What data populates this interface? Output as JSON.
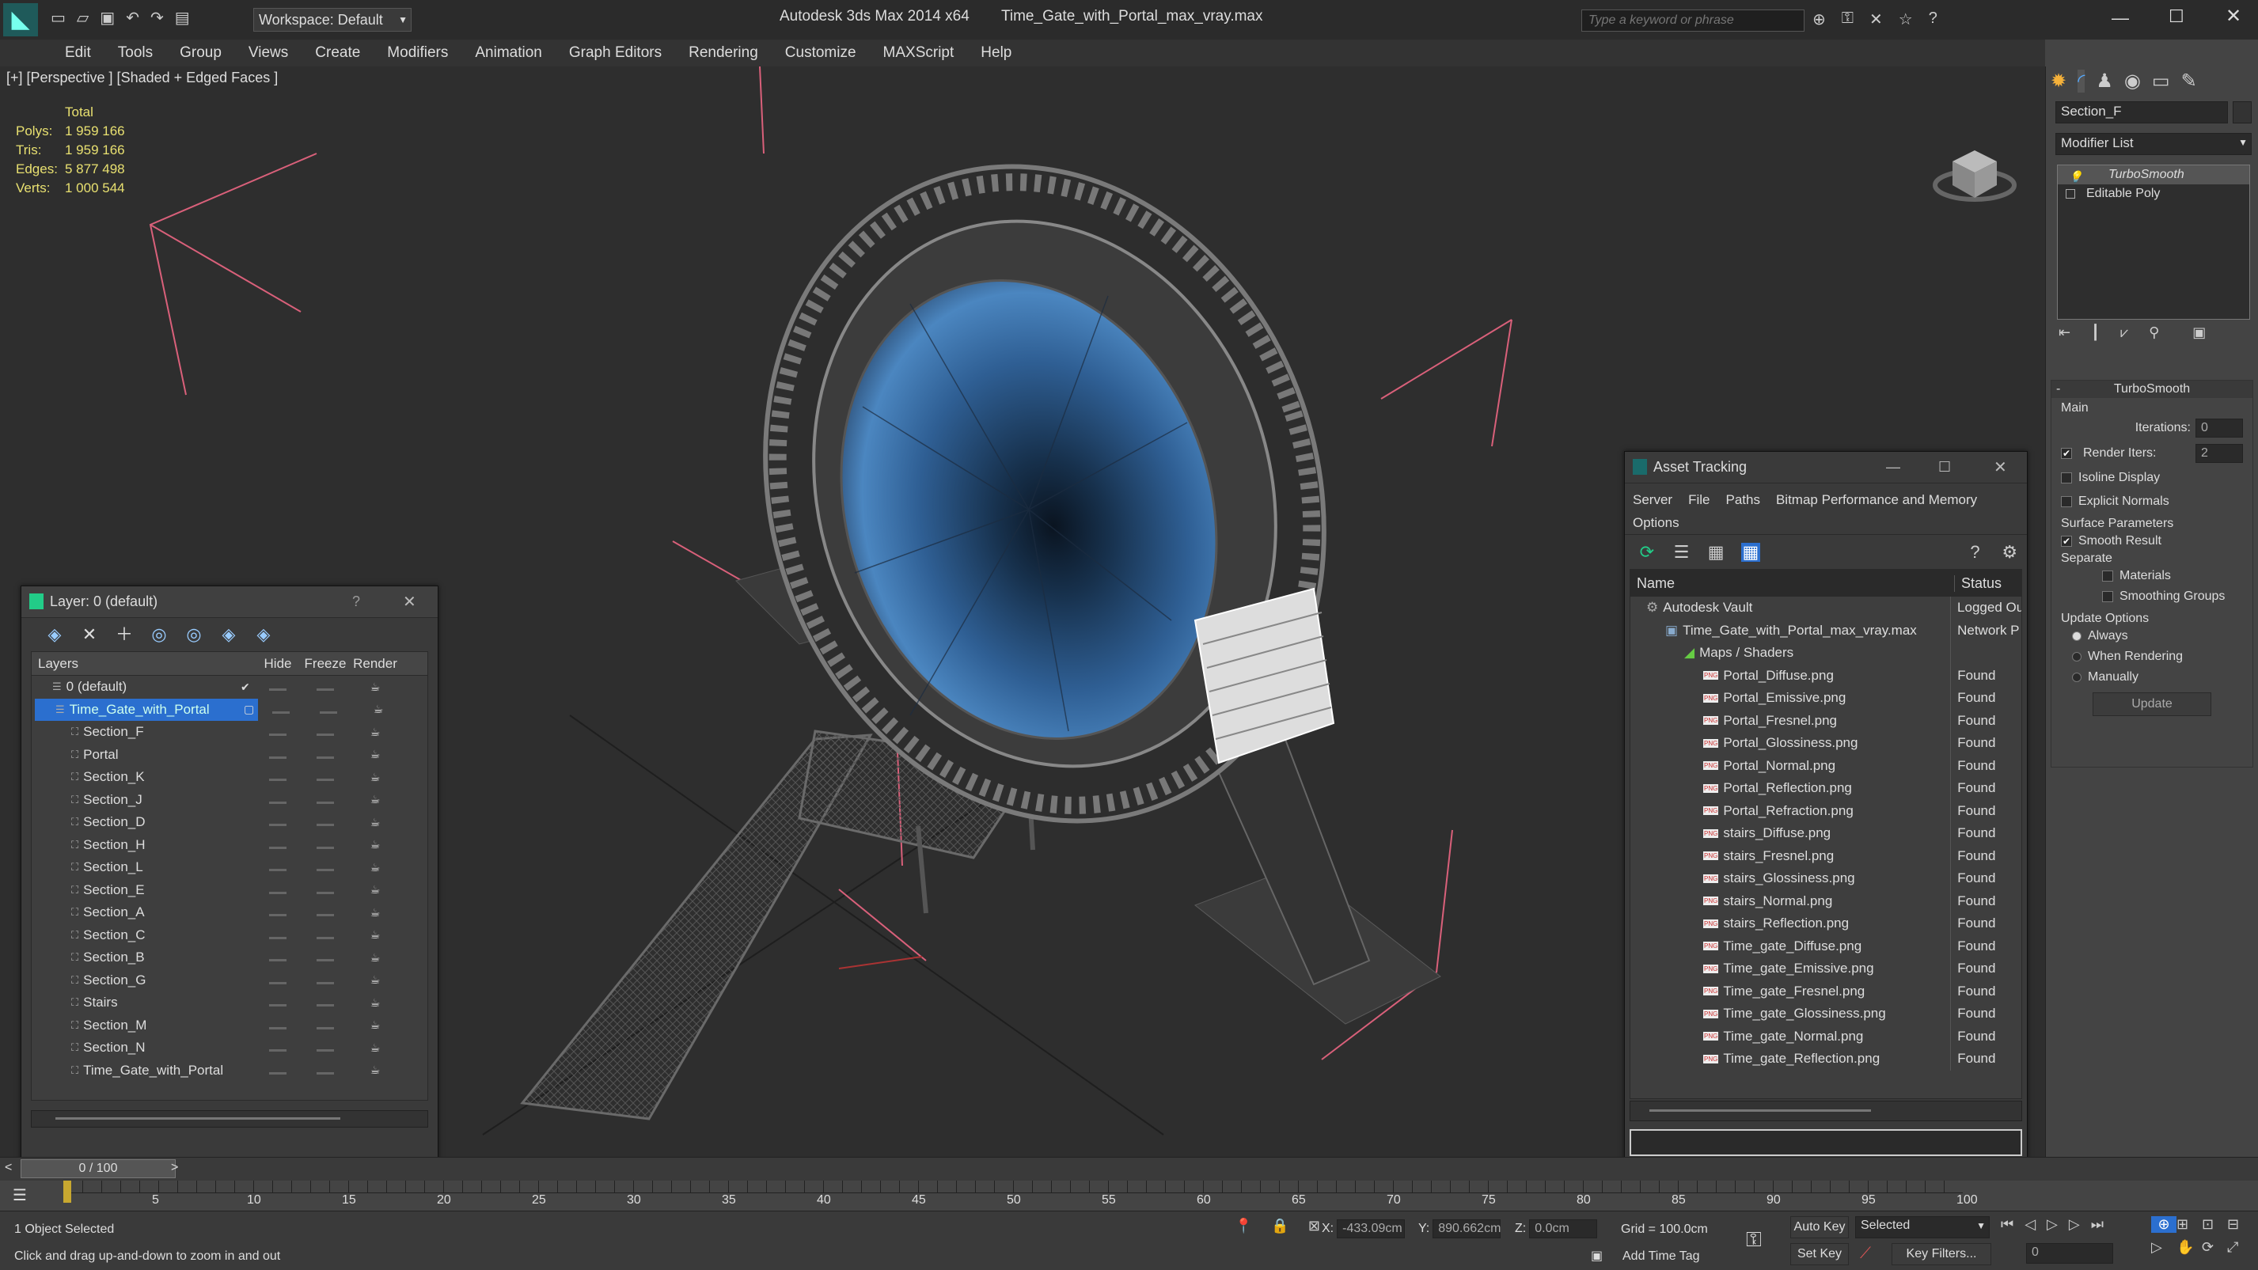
{
  "app": {
    "title": "Autodesk 3ds Max  2014 x64",
    "file": "Time_Gate_with_Portal_max_vray.max",
    "workspace": "Workspace: Default",
    "search_placeholder": "Type a keyword or phrase"
  },
  "menu": [
    "Edit",
    "Tools",
    "Group",
    "Views",
    "Create",
    "Modifiers",
    "Animation",
    "Graph Editors",
    "Rendering",
    "Customize",
    "MAXScript",
    "Help"
  ],
  "viewport": {
    "label": "[+] [Perspective ] [Shaded + Edged Faces ]",
    "stats_header": "Total",
    "stats": [
      {
        "label": "Polys:",
        "value": "1 959 166"
      },
      {
        "label": "Tris:",
        "value": "1 959 166"
      },
      {
        "label": "Edges:",
        "value": "5 877 498"
      },
      {
        "label": "Verts:",
        "value": "1 000 544"
      }
    ]
  },
  "layer_window": {
    "title": "Layer: 0 (default)",
    "help": "?",
    "columns": [
      "Layers",
      "Hide",
      "Freeze",
      "Render"
    ],
    "layers": [
      {
        "name": "0 (default)",
        "level": 0,
        "selected": false
      },
      {
        "name": "Time_Gate_with_Portal",
        "level": 0,
        "selected": true
      },
      {
        "name": "Section_F",
        "level": 1,
        "selected": false
      },
      {
        "name": "Portal",
        "level": 1,
        "selected": false
      },
      {
        "name": "Section_K",
        "level": 1,
        "selected": false
      },
      {
        "name": "Section_J",
        "level": 1,
        "selected": false
      },
      {
        "name": "Section_D",
        "level": 1,
        "selected": false
      },
      {
        "name": "Section_H",
        "level": 1,
        "selected": false
      },
      {
        "name": "Section_L",
        "level": 1,
        "selected": false
      },
      {
        "name": "Section_E",
        "level": 1,
        "selected": false
      },
      {
        "name": "Section_A",
        "level": 1,
        "selected": false
      },
      {
        "name": "Section_C",
        "level": 1,
        "selected": false
      },
      {
        "name": "Section_B",
        "level": 1,
        "selected": false
      },
      {
        "name": "Section_G",
        "level": 1,
        "selected": false
      },
      {
        "name": "Stairs",
        "level": 1,
        "selected": false
      },
      {
        "name": "Section_M",
        "level": 1,
        "selected": false
      },
      {
        "name": "Section_N",
        "level": 1,
        "selected": false
      },
      {
        "name": "Time_Gate_with_Portal",
        "level": 1,
        "selected": false
      }
    ]
  },
  "asset_window": {
    "title": "Asset Tracking",
    "menu": [
      "Server",
      "File",
      "Paths",
      "Bitmap Performance and Memory"
    ],
    "menu2": "Options",
    "columns": [
      "Name",
      "Status"
    ],
    "rows": [
      {
        "name": "Autodesk Vault",
        "status": "Logged Ou",
        "level": 0
      },
      {
        "name": "Time_Gate_with_Portal_max_vray.max",
        "status": "Network P",
        "level": 1
      },
      {
        "name": "Maps / Shaders",
        "status": "",
        "level": 2
      },
      {
        "name": "Portal_Diffuse.png",
        "status": "Found",
        "level": 3
      },
      {
        "name": "Portal_Emissive.png",
        "status": "Found",
        "level": 3
      },
      {
        "name": "Portal_Fresnel.png",
        "status": "Found",
        "level": 3
      },
      {
        "name": "Portal_Glossiness.png",
        "status": "Found",
        "level": 3
      },
      {
        "name": "Portal_Normal.png",
        "status": "Found",
        "level": 3
      },
      {
        "name": "Portal_Reflection.png",
        "status": "Found",
        "level": 3
      },
      {
        "name": "Portal_Refraction.png",
        "status": "Found",
        "level": 3
      },
      {
        "name": "stairs_Diffuse.png",
        "status": "Found",
        "level": 3
      },
      {
        "name": "stairs_Fresnel.png",
        "status": "Found",
        "level": 3
      },
      {
        "name": "stairs_Glossiness.png",
        "status": "Found",
        "level": 3
      },
      {
        "name": "stairs_Normal.png",
        "status": "Found",
        "level": 3
      },
      {
        "name": "stairs_Reflection.png",
        "status": "Found",
        "level": 3
      },
      {
        "name": "Time_gate_Diffuse.png",
        "status": "Found",
        "level": 3
      },
      {
        "name": "Time_gate_Emissive.png",
        "status": "Found",
        "level": 3
      },
      {
        "name": "Time_gate_Fresnel.png",
        "status": "Found",
        "level": 3
      },
      {
        "name": "Time_gate_Glossiness.png",
        "status": "Found",
        "level": 3
      },
      {
        "name": "Time_gate_Normal.png",
        "status": "Found",
        "level": 3
      },
      {
        "name": "Time_gate_Reflection.png",
        "status": "Found",
        "level": 3
      }
    ]
  },
  "cmd_panel": {
    "object_name": "Section_F",
    "modifier_list": "Modifier List",
    "stack": [
      "TurboSmooth",
      "Editable Poly"
    ],
    "rollout_title": "TurboSmooth",
    "main_label": "Main",
    "iterations_label": "Iterations:",
    "iterations_value": "0",
    "render_iters_label": "Render Iters:",
    "render_iters_value": "2",
    "isoline": "Isoline Display",
    "explicit": "Explicit Normals",
    "surface_params": "Surface Parameters",
    "smooth_result": "Smooth Result",
    "separate": "Separate",
    "materials": "Materials",
    "smoothing_groups": "Smoothing Groups",
    "update_options": "Update Options",
    "always": "Always",
    "when_rendering": "When Rendering",
    "manually": "Manually",
    "update": "Update"
  },
  "timeline": {
    "frame": "0 / 100",
    "ticks": [
      "5",
      "10",
      "15",
      "20",
      "25",
      "30",
      "35",
      "40",
      "45",
      "50",
      "55",
      "60",
      "65",
      "70",
      "75",
      "80",
      "85",
      "90",
      "95",
      "100"
    ]
  },
  "status": {
    "selected": "1 Object Selected",
    "prompt": "Click and drag up-and-down to zoom in and out",
    "x_label": "X:",
    "x": "-433.09cm",
    "y_label": "Y:",
    "y": "890.662cm",
    "z_label": "Z:",
    "z": "0.0cm",
    "grid": "Grid = 100.0cm",
    "add_time_tag": "Add Time Tag",
    "auto_key": "Auto Key",
    "set_key": "Set Key",
    "selected_dd": "Selected",
    "key_filters": "Key Filters...",
    "frame_field": "0"
  },
  "colors": {
    "accent": "#3a78c8",
    "selection": "#2b6fcf",
    "viewport_bg": "#2e2e2e"
  }
}
